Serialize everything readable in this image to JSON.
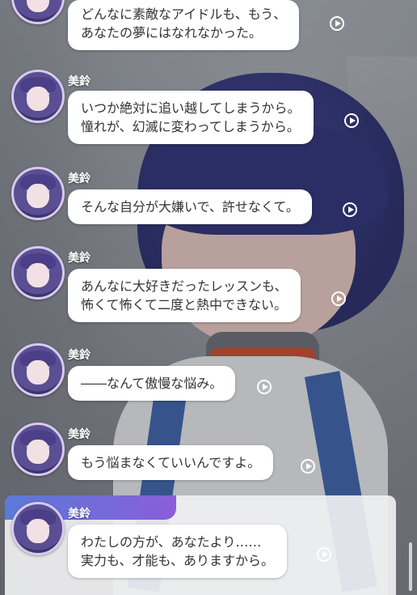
{
  "speaker_name": "美鈴",
  "messages": [
    {
      "lines": [
        "どんなに素敵なアイドルも、もう、",
        "あなたの夢にはなれなかった。"
      ]
    },
    {
      "lines": [
        "いつか絶対に追い越してしまうから。",
        "憧れが、幻滅に変わってしまうから。"
      ]
    },
    {
      "lines": [
        "そんな自分が大嫌いで、許せなくて。"
      ]
    },
    {
      "lines": [
        "あんなに大好きだったレッスンも、",
        "怖くて怖くて二度と熱中できない。"
      ]
    },
    {
      "lines": [
        "――なんて傲慢な悩み。"
      ]
    },
    {
      "lines": [
        "もう悩まなくていいんですよ。"
      ]
    },
    {
      "lines": [
        "わたしの方が、あなたより……",
        "実力も、才能も、ありますから。"
      ]
    }
  ],
  "icons": {
    "play": "play-circle-icon",
    "avatar": "character-portrait"
  }
}
